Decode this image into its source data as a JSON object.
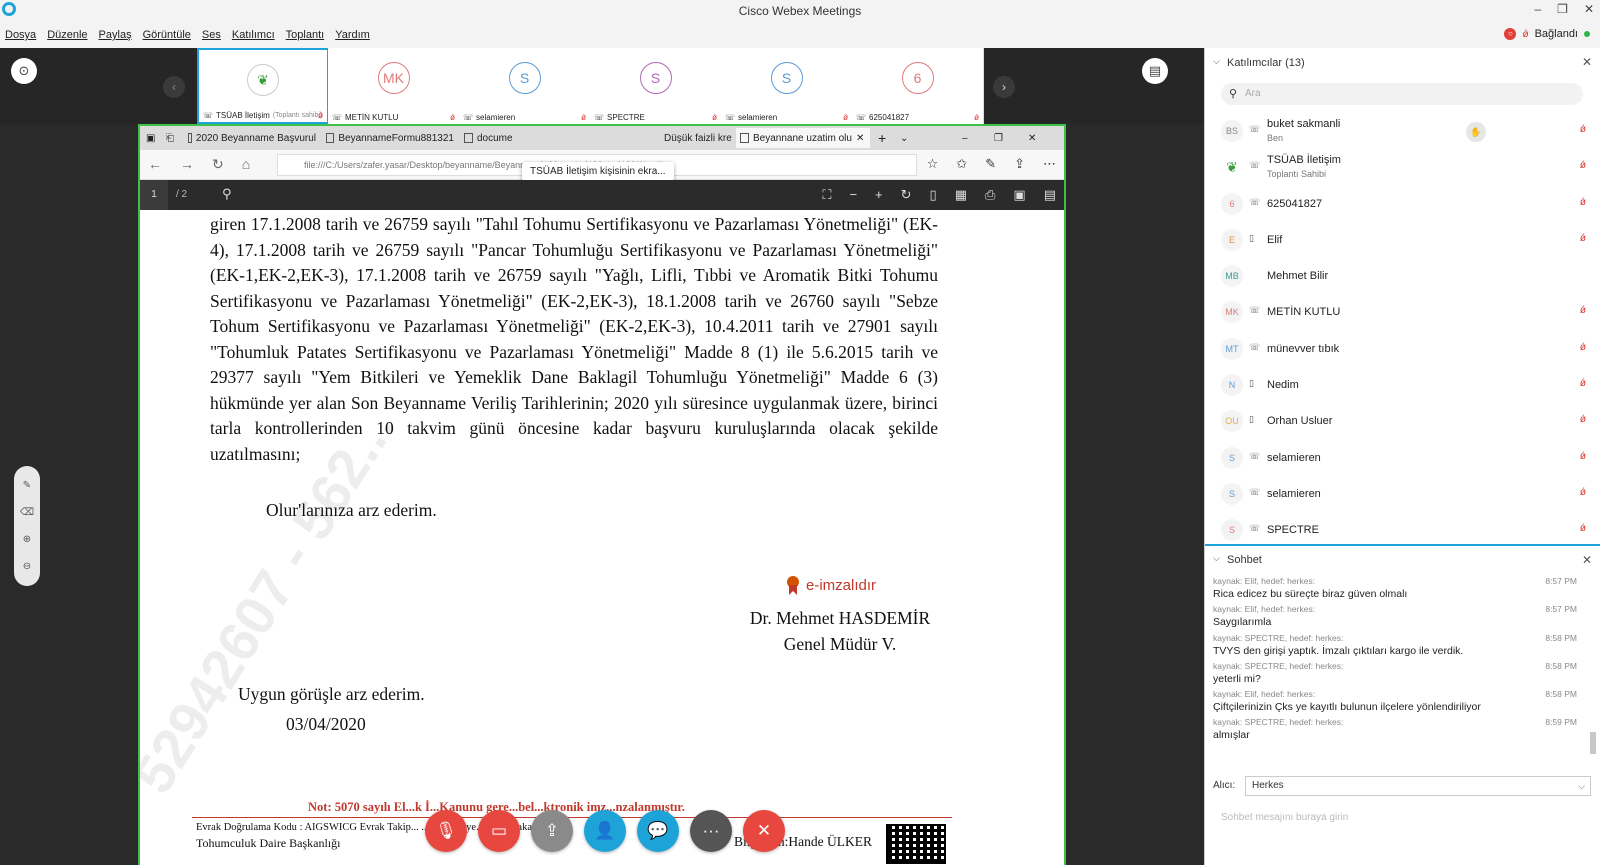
{
  "window": {
    "title": "Cisco Webex Meetings",
    "minimize": "–",
    "restore": "❐",
    "close": "✕"
  },
  "menu": [
    "Dosya",
    "Düzenle",
    "Paylaş",
    "Görüntüle",
    "Ses",
    "Katılımcı",
    "Toplantı",
    "Yardım"
  ],
  "connection": {
    "status": "Bağlandı",
    "rec": "○",
    "mic": "🎙"
  },
  "thumbnails": [
    {
      "initials": "",
      "name": "TSÜAB İletişim",
      "role": "(Toplantı sahibi)",
      "active": true
    },
    {
      "initials": "MK",
      "name": "METİN KUTLU",
      "color": "#e07a7a"
    },
    {
      "initials": "S",
      "name": "selamieren",
      "color": "#5b9bd5"
    },
    {
      "initials": "S",
      "name": "SPECTRE",
      "color": "#b06ab3"
    },
    {
      "initials": "S",
      "name": "selamieren",
      "color": "#5b9bd5"
    },
    {
      "initials": "6",
      "name": "625041827",
      "color": "#e07a7a"
    }
  ],
  "browser": {
    "tabs": [
      "2020 Beyanname Başvurul",
      "BeyannameFormu881321",
      "docume",
      "Düşük faizli kre",
      "Beyannane uzatim olu"
    ],
    "tooltip": "TSÜAB İletişim kişisinin ekra...",
    "url": "file:///C:/Users/zafer.yasar/Desktop/beyanname/Beyannane%20uzatim%20olur%20(1).pdf",
    "page_current": "1",
    "page_total": "/ 2"
  },
  "document": {
    "body": "giren 17.1.2008 tarih ve 26759 sayılı \"Tahıl Tohumu Sertifikasyonu ve Pazarlaması Yönetmeliği\" (EK-4), 17.1.2008 tarih ve 26759 sayılı \"Pancar Tohumluğu Sertifikasyonu ve Pazarlaması Yönetmeliği\" (EK-1,EK-2,EK-3), 17.1.2008 tarih ve 26759 sayılı \"Yağlı, Lifli, Tıbbi ve Aromatik Bitki Tohumu Sertifikasyonu ve Pazarlaması Yönetmeliği\" (EK-2,EK-3), 18.1.2008 tarih ve 26760 sayılı \"Sebze Tohum Sertifikasyonu ve Pazarlaması Yönetmeliği\" (EK-2,EK-3), 10.4.2011 tarih ve 27901 sayılı \"Tohumluk Patates Sertifikasyonu ve Pazarlaması Yönetmeliği\" Madde 8 (1) ile 5.6.2015 tarih ve 29377 sayılı \"Yem Bitkileri ve Yemeklik Dane Baklagil Tohumluğu Yönetmeliği\" Madde 6 (3) hükmünde yer alan Son Beyanname Veriliş Tarihlerinin; 2020 yılı süresince uygulanmak üzere, birinci tarla kontrollerinden 10 takvim günü öncesine kadar başvuru kuruluşlarında olacak şekilde uzatılmasını;",
    "olur": "Olur'larınıza arz ederim.",
    "watermark": "52942607 - 562...",
    "eimza": "e-imzalıdır",
    "signer_name": "Dr. Mehmet HASDEMİR",
    "signer_title": "Genel Müdür V.",
    "approval": "Uygun görüşle arz ederim.",
    "date": "03/04/2020",
    "note": "Not: 5070 sayılı El...k İ...Kanunu gere...bel...ktronik imz...nzalanmıştır.",
    "footer_code": "Evrak Doğrulama Kodu : AIGSWICG Evrak Takip...      ...ww.turkiye.gov...      ...bakanlig-ebys",
    "footer_dept": "Tohumculuk Daire Başkanlığı",
    "footer_info": "Bilgi için:Hande ÜLKER"
  },
  "controls": [
    {
      "name": "mute-button",
      "glyph": "🎙",
      "color": "#e8473f"
    },
    {
      "name": "video-button",
      "glyph": "▭",
      "color": "#e8473f"
    },
    {
      "name": "share-button",
      "glyph": "⇪",
      "color": "#8a8a8a"
    },
    {
      "name": "participants-button",
      "glyph": "👤",
      "color": "#1ea3d8"
    },
    {
      "name": "chat-button",
      "glyph": "💬",
      "color": "#1ea3d8"
    },
    {
      "name": "more-button",
      "glyph": "···",
      "color": "#555555"
    },
    {
      "name": "leave-button",
      "glyph": "✕",
      "color": "#e8473f"
    }
  ],
  "participants": {
    "header": "Katılımcılar (13)",
    "search_placeholder": "Ara",
    "list": [
      {
        "initials": "BS",
        "name": "buket sakmanli",
        "sub": "Ben",
        "color": "#888",
        "icon": "phone"
      },
      {
        "initials": "",
        "name": "TSÜAB İletişim",
        "sub": "Toplantı Sahibi",
        "color": "#3a9c3a",
        "icon": "phone"
      },
      {
        "initials": "6",
        "name": "625041827",
        "sub": "",
        "color": "#e07a7a",
        "icon": "phone"
      },
      {
        "initials": "E",
        "name": "Elif",
        "sub": "",
        "color": "#e0904a",
        "icon": "device"
      },
      {
        "initials": "MB",
        "name": "Mehmet Bilir",
        "sub": "",
        "color": "#3a9c8c",
        "icon": ""
      },
      {
        "initials": "MK",
        "name": "METİN KUTLU",
        "sub": "",
        "color": "#e07a7a",
        "icon": "phone"
      },
      {
        "initials": "MT",
        "name": "münevver tıbık",
        "sub": "",
        "color": "#5b9bd5",
        "icon": "phone"
      },
      {
        "initials": "N",
        "name": "Nedim",
        "sub": "",
        "color": "#5b9bd5",
        "icon": "device"
      },
      {
        "initials": "OU",
        "name": "Orhan Usluer",
        "sub": "",
        "color": "#e0b04a",
        "icon": "device"
      },
      {
        "initials": "S",
        "name": "selamieren",
        "sub": "",
        "color": "#5b9bd5",
        "icon": "phone"
      },
      {
        "initials": "S",
        "name": "selamieren",
        "sub": "",
        "color": "#5b9bd5",
        "icon": "phone"
      },
      {
        "initials": "S",
        "name": "SPECTRE",
        "sub": "",
        "color": "#e07a7a",
        "icon": "phone"
      }
    ]
  },
  "chat": {
    "header": "Sohbet",
    "messages": [
      {
        "meta": "kaynak: Elif, hedef: herkes:",
        "time": "8:57 PM",
        "text": "Rica edicez bu süreçte biraz güven olmalı"
      },
      {
        "meta": "kaynak: Elif, hedef: herkes:",
        "time": "8:57 PM",
        "text": "Saygılarımla"
      },
      {
        "meta": "kaynak: SPECTRE, hedef: herkes:",
        "time": "8:58 PM",
        "text": "TVYS den girişi yaptık. İmzalı çıktıları kargo ile verdik."
      },
      {
        "meta": "kaynak: SPECTRE, hedef: herkes:",
        "time": "8:58 PM",
        "text": "yeterli mi?"
      },
      {
        "meta": "kaynak: Elif, hedef: herkes:",
        "time": "8:58 PM",
        "text": "Çiftçilerinizin Çks ye kayıtlı bulunun ilçelere yönlendiriliyor"
      },
      {
        "meta": "kaynak: SPECTRE, hedef: herkes:",
        "time": "8:59 PM",
        "text": "almışlar"
      }
    ],
    "recipient_label": "Alıcı:",
    "recipient": "Herkes",
    "input_placeholder": "Sohbet mesajını buraya girin"
  }
}
